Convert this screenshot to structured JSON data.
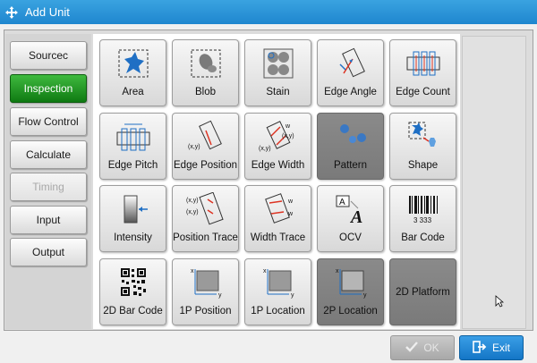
{
  "window": {
    "title": "Add Unit"
  },
  "sidebar": {
    "items": [
      {
        "label": "Sourcec",
        "state": "normal"
      },
      {
        "label": "Inspection",
        "state": "active"
      },
      {
        "label": "Flow Control",
        "state": "normal"
      },
      {
        "label": "Calculate",
        "state": "normal"
      },
      {
        "label": "Timing",
        "state": "disabled"
      },
      {
        "label": "Input",
        "state": "normal"
      },
      {
        "label": "Output",
        "state": "normal"
      }
    ]
  },
  "tiles": [
    {
      "label": "Area",
      "icon": "area-icon"
    },
    {
      "label": "Blob",
      "icon": "blob-icon"
    },
    {
      "label": "Stain",
      "icon": "stain-icon"
    },
    {
      "label": "Edge Angle",
      "icon": "edge-angle-icon"
    },
    {
      "label": "Edge Count",
      "icon": "edge-count-icon"
    },
    {
      "label": "Edge Pitch",
      "icon": "edge-pitch-icon"
    },
    {
      "label": "Edge Position",
      "icon": "edge-position-icon",
      "icon_text": "(x,y)"
    },
    {
      "label": "Edge Width",
      "icon": "edge-width-icon",
      "icon_text": "(x,y)",
      "icon_text2": "w"
    },
    {
      "label": "Pattern",
      "icon": "pattern-icon",
      "selected": true
    },
    {
      "label": "Shape",
      "icon": "shape-icon"
    },
    {
      "label": "Intensity",
      "icon": "intensity-icon"
    },
    {
      "label": "Position Trace",
      "icon": "position-trace-icon",
      "icon_text": "(x,y)"
    },
    {
      "label": "Width Trace",
      "icon": "width-trace-icon",
      "icon_text2": "w"
    },
    {
      "label": "OCV",
      "icon": "ocv-icon",
      "icon_text": "A",
      "icon_text2": "A"
    },
    {
      "label": "Bar Code",
      "icon": "bar-code-icon",
      "icon_text": "3 333"
    },
    {
      "label": "2D Bar Code",
      "icon": "qr-code-icon"
    },
    {
      "label": "1P Position",
      "icon": "1p-position-icon"
    },
    {
      "label": "1P Location",
      "icon": "1p-location-icon"
    },
    {
      "label": "2P Location",
      "icon": "2p-location-icon",
      "selected": true
    },
    {
      "label": "2D Platform",
      "icon": "2d-platform-icon",
      "selected": true
    }
  ],
  "footer": {
    "ok_label": "OK",
    "exit_label": "Exit",
    "ok_enabled": false
  },
  "colors": {
    "titlebar": "#2a93d8",
    "active": "#1a8c1d",
    "exit": "#1d82d0"
  }
}
